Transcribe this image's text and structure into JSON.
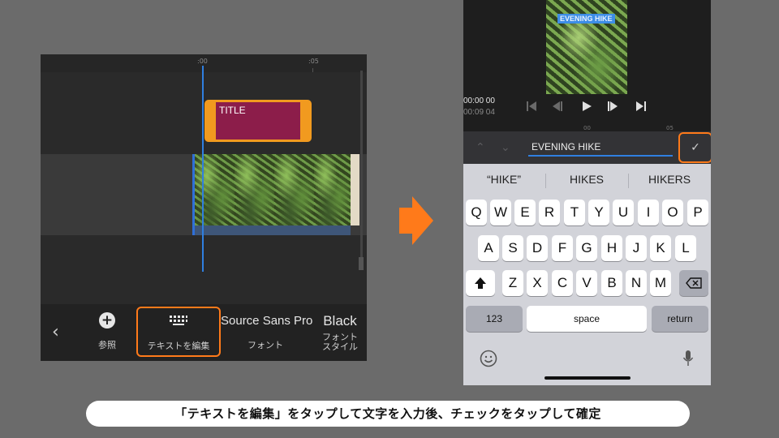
{
  "timeline": {
    "ruler_labels": [
      ":00",
      ":05"
    ],
    "title_clip_label": "TITLE"
  },
  "toolbar": {
    "back_icon": "chevron-left-icon",
    "browse_label": "参照",
    "browse_icon": "plus-circle-icon",
    "edit_text_label": "テキストを編集",
    "edit_text_icon": "keyboard-icon",
    "font_name": "Source Sans Pro",
    "font_label": "フォント",
    "style_name": "Black",
    "style_label_line1": "フォント",
    "style_label_line2": "スタイル"
  },
  "preview": {
    "title_text": "EVENING HIKE",
    "time_current": "00:00 00",
    "time_total": "00:09 04",
    "mini_ruler_labels": [
      "00",
      "05"
    ]
  },
  "editor": {
    "input_value": "EVENING HIKE",
    "confirm_icon": "checkmark-icon"
  },
  "keyboard": {
    "suggestions": [
      "“HIKE”",
      "HIKES",
      "HIKERS"
    ],
    "row1": [
      "Q",
      "W",
      "E",
      "R",
      "T",
      "Y",
      "U",
      "I",
      "O",
      "P"
    ],
    "row2": [
      "A",
      "S",
      "D",
      "F",
      "G",
      "H",
      "J",
      "K",
      "L"
    ],
    "row3": [
      "Z",
      "X",
      "C",
      "V",
      "B",
      "N",
      "M"
    ],
    "key_123": "123",
    "key_space": "space",
    "key_return": "return"
  },
  "caption": "「テキストを編集」をタップして文字を入力後、チェックをタップして確定",
  "colors": {
    "highlight": "#ff7a1a",
    "playhead": "#2f7fe0",
    "title_clip": "#8c1d4a",
    "title_clip_border": "#f19a1f"
  }
}
